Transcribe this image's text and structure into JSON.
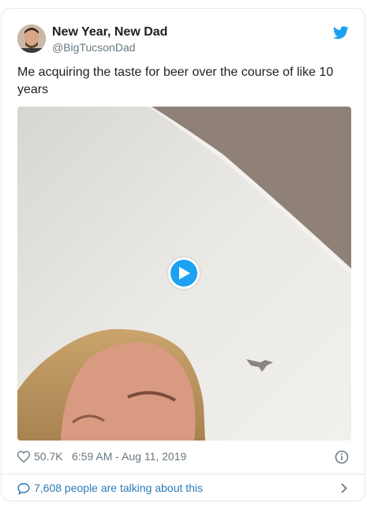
{
  "tweet": {
    "display_name": "New Year, New Dad",
    "handle": "@BigTucsonDad",
    "text": "Me acquiring the taste for beer over the course of like 10 years",
    "likes": "50.7K",
    "timestamp": "6:59 AM - Aug 11, 2019",
    "conversation": "7,608 people are talking about this"
  },
  "icons": {
    "brand": "twitter-bird-icon",
    "play": "play-icon",
    "like": "heart-icon",
    "info": "info-icon",
    "reply": "speech-bubble-icon",
    "more": "chevron-right-icon"
  },
  "colors": {
    "brand_blue": "#1da1f2",
    "link_blue": "#2b7bb9",
    "muted_gray": "#697882",
    "border": "#e1e8ed"
  }
}
